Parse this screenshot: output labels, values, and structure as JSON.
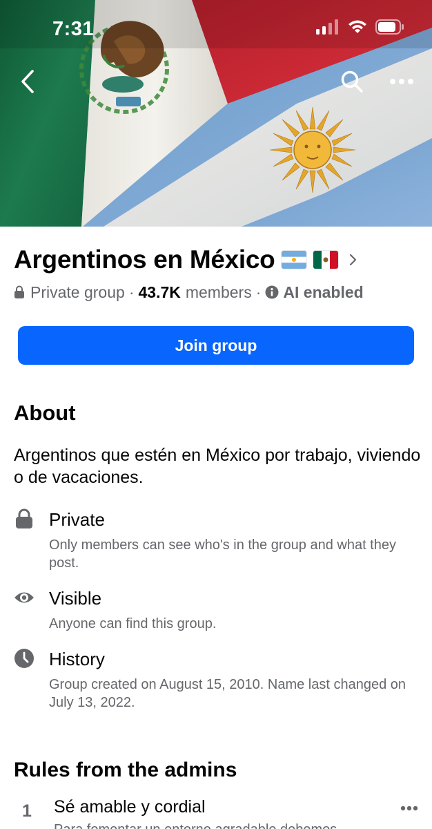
{
  "status_bar": {
    "time": "7:31"
  },
  "icons": {
    "back": "chevron-left-icon",
    "search": "search-icon",
    "more": "more-horizontal-icon",
    "lock": "lock-icon",
    "info": "info-icon",
    "eye": "eye-icon",
    "clock": "clock-icon",
    "chevron": "chevron-right-icon"
  },
  "colors": {
    "primary": "#0866ff",
    "secondary_text": "#65676b",
    "icon_gray": "#65676b",
    "cover_green": "#1d7a4e",
    "cover_red": "#cc2a36",
    "cover_blue": "#7ea9d6",
    "sun_gold": "#e8a928"
  },
  "group": {
    "name": "Argentinos en México",
    "privacy": "Private group",
    "members_count": "43.7K",
    "members_label": "members",
    "ai_label": "AI enabled",
    "join_label": "Join group"
  },
  "about": {
    "heading": "About",
    "description": "Argentinos que estén en México por trabajo, viviendo o de vacaciones.",
    "items": [
      {
        "title": "Private",
        "description": "Only members can see who's in the group and what they post."
      },
      {
        "title": "Visible",
        "description": "Anyone can find this group."
      },
      {
        "title": "History",
        "description": "Group created on August 15, 2010. Name last changed on July 13, 2022."
      }
    ]
  },
  "rules": {
    "heading": "Rules from the admins",
    "items": [
      {
        "number": "1",
        "title": "Sé amable y cordial",
        "description": "Para fomentar un entorno agradable debemos"
      }
    ]
  }
}
